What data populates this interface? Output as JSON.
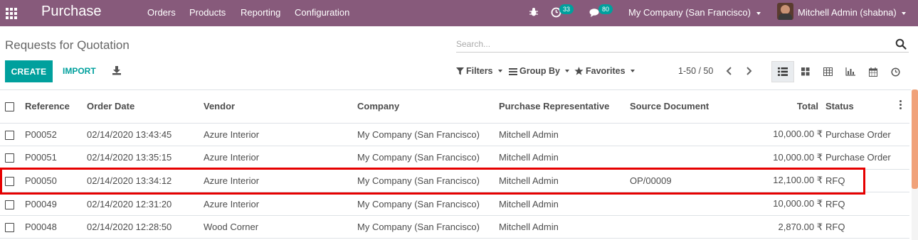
{
  "navbar": {
    "brand": "Purchase",
    "menu": [
      {
        "label": "Orders"
      },
      {
        "label": "Products"
      },
      {
        "label": "Reporting"
      },
      {
        "label": "Configuration"
      }
    ],
    "activity_count": "33",
    "messages_count": "80",
    "company": "My Company (San Francisco)",
    "user": "Mitchell Admin (shabna)",
    "color": "#875a7b"
  },
  "control_panel": {
    "title": "Requests for Quotation",
    "search_placeholder": "Search...",
    "create_label": "CREATE",
    "import_label": "IMPORT",
    "filters_label": "Filters",
    "group_by_label": "Group By",
    "favorites_label": "Favorites",
    "pager": "1-50 / 50",
    "accent": "#00a09d"
  },
  "table": {
    "columns": [
      "Reference",
      "Order Date",
      "Vendor",
      "Company",
      "Purchase Representative",
      "Source Document",
      "Total",
      "Status"
    ],
    "rows": [
      {
        "reference": "P00052",
        "order_date": "02/14/2020 13:43:45",
        "vendor": "Azure Interior",
        "company": "My Company (San Francisco)",
        "rep": "Mitchell Admin",
        "source": "",
        "total": "10,000.00 ₹",
        "status": "Purchase Order"
      },
      {
        "reference": "P00051",
        "order_date": "02/14/2020 13:35:15",
        "vendor": "Azure Interior",
        "company": "My Company (San Francisco)",
        "rep": "Mitchell Admin",
        "source": "",
        "total": "10,000.00 ₹",
        "status": "Purchase Order"
      },
      {
        "reference": "P00050",
        "order_date": "02/14/2020 13:34:12",
        "vendor": "Azure Interior",
        "company": "My Company (San Francisco)",
        "rep": "Mitchell Admin",
        "source": "OP/00009",
        "total": "12,100.00 ₹",
        "status": "RFQ"
      },
      {
        "reference": "P00049",
        "order_date": "02/14/2020 12:31:20",
        "vendor": "Azure Interior",
        "company": "My Company (San Francisco)",
        "rep": "Mitchell Admin",
        "source": "",
        "total": "10,000.00 ₹",
        "status": "RFQ"
      },
      {
        "reference": "P00048",
        "order_date": "02/14/2020 12:28:50",
        "vendor": "Wood Corner",
        "company": "My Company (San Francisco)",
        "rep": "Mitchell Admin",
        "source": "",
        "total": "2,870.00 ₹",
        "status": "RFQ"
      }
    ]
  },
  "highlight_color": "#e60000"
}
